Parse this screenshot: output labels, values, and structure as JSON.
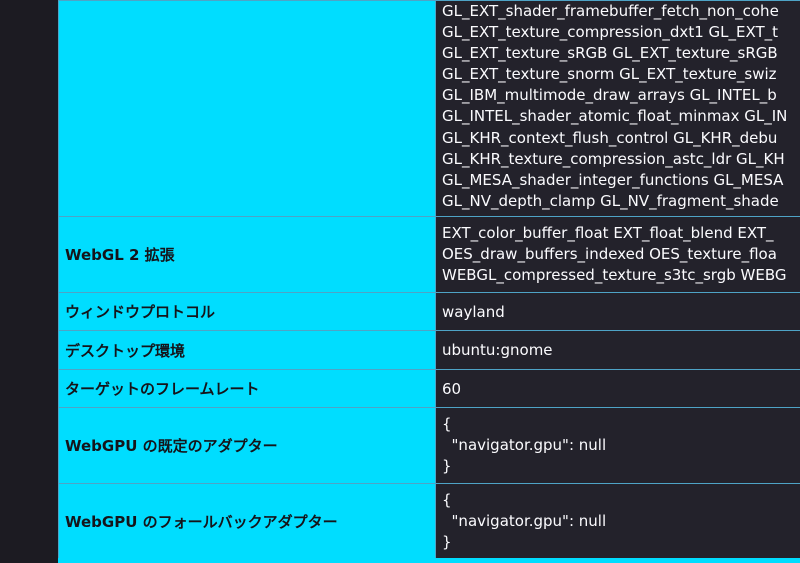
{
  "colors": {
    "page_bg": "#1c1b22",
    "key_bg": "#00ddff",
    "value_bg": "#23222b",
    "border": "#4ea3c6"
  },
  "ext_row": {
    "label": "",
    "lines": [
      "GL_EXT_shader_framebuffer_fetch_non_cohe",
      "GL_EXT_texture_compression_dxt1 GL_EXT_t",
      "GL_EXT_texture_sRGB GL_EXT_texture_sRGB",
      "GL_EXT_texture_snorm GL_EXT_texture_swiz",
      "GL_IBM_multimode_draw_arrays GL_INTEL_b",
      "GL_INTEL_shader_atomic_float_minmax GL_IN",
      "GL_KHR_context_flush_control GL_KHR_debu",
      "GL_KHR_texture_compression_astc_ldr GL_KH",
      "GL_MESA_shader_integer_functions GL_MESA",
      "GL_NV_depth_clamp GL_NV_fragment_shade"
    ]
  },
  "webgl2_row": {
    "label": "WebGL 2 拡張",
    "lines": [
      "EXT_color_buffer_float EXT_float_blend EXT_",
      "OES_draw_buffers_indexed OES_texture_floa",
      "WEBGL_compressed_texture_s3tc_srgb WEBG"
    ]
  },
  "window_protocol": {
    "label": "ウィンドウプロトコル",
    "value": "wayland"
  },
  "desktop_env": {
    "label": "デスクトップ環境",
    "value": "ubuntu:gnome"
  },
  "target_framerate": {
    "label": "ターゲットのフレームレート",
    "value": "60"
  },
  "webgpu_default": {
    "label": "WebGPU の既定のアダプター",
    "value": "{\n  \"navigator.gpu\": null\n}"
  },
  "webgpu_fallback": {
    "label": "WebGPU のフォールバックアダプター",
    "value": "{\n  \"navigator.gpu\": null\n}"
  }
}
